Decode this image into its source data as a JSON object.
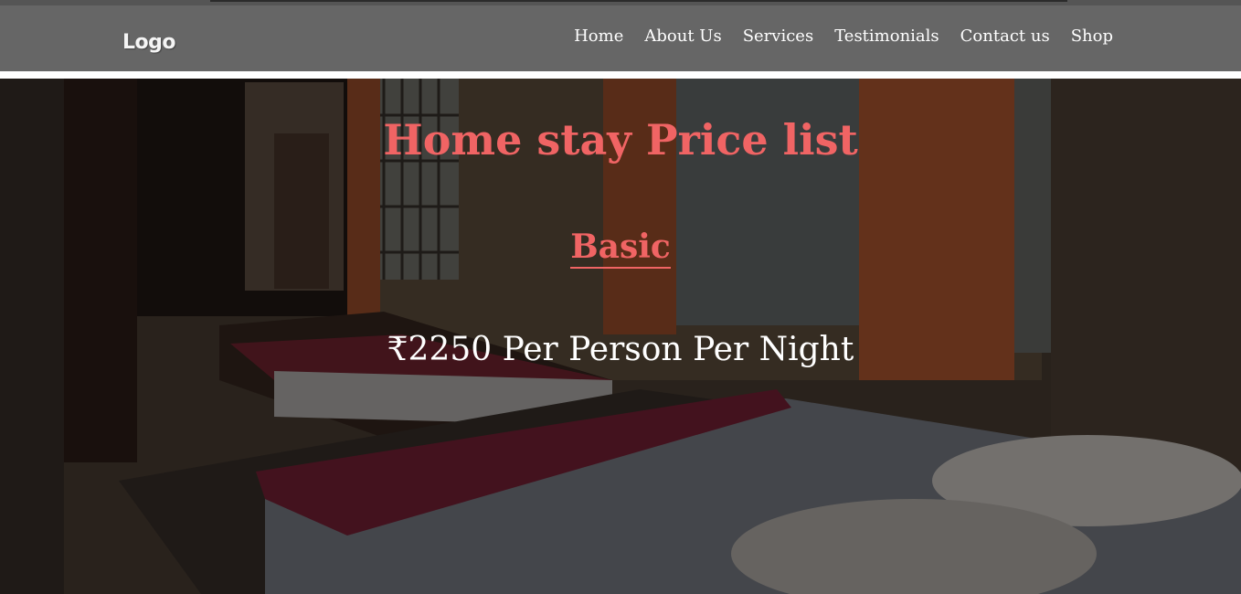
{
  "header": {
    "logo": "Logo",
    "nav": [
      "Home",
      "About Us",
      "Services",
      "Testimonials",
      "Contact us",
      "Shop"
    ]
  },
  "hero": {
    "title": "Home stay Price list",
    "tier": "Basic",
    "price": "₹2250 Per Person Per Night",
    "image": "bedroom-photo"
  },
  "colors": {
    "navbar": "#666666",
    "accent": "#f06464",
    "text_light": "#ffffff"
  }
}
